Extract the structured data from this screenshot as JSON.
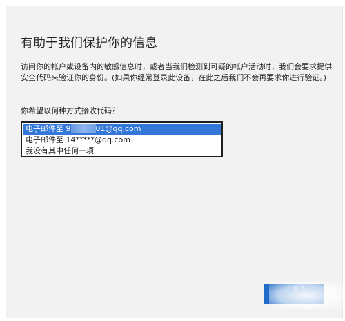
{
  "dialog": {
    "title": "有助于我们保护你的信息",
    "description": "访问你的帐户或设备内的敏感信息时，或者当我们检测到可疑的帐户活动时，我们会要求提供安全代码来验证你的身份。(如果你经常登录此设备，在此之后我们不会再要求你进行验证。)",
    "question": "你希望以何种方式接收代码？",
    "options": [
      {
        "prefix": "电子邮件至 9",
        "suffix": "01@qq.com",
        "masked": true,
        "selected": true
      },
      {
        "prefix": "电子邮件至 14*****@qq.com",
        "suffix": "",
        "masked": false,
        "selected": false
      },
      {
        "prefix": "我没有其中任何一项",
        "suffix": "",
        "masked": false,
        "selected": false
      }
    ],
    "next_label": ""
  },
  "colors": {
    "panel_bg": "#f2f2f2",
    "selected_bg": "#3378d8",
    "button_bg": "#1f6cc9",
    "text": "#262626"
  }
}
